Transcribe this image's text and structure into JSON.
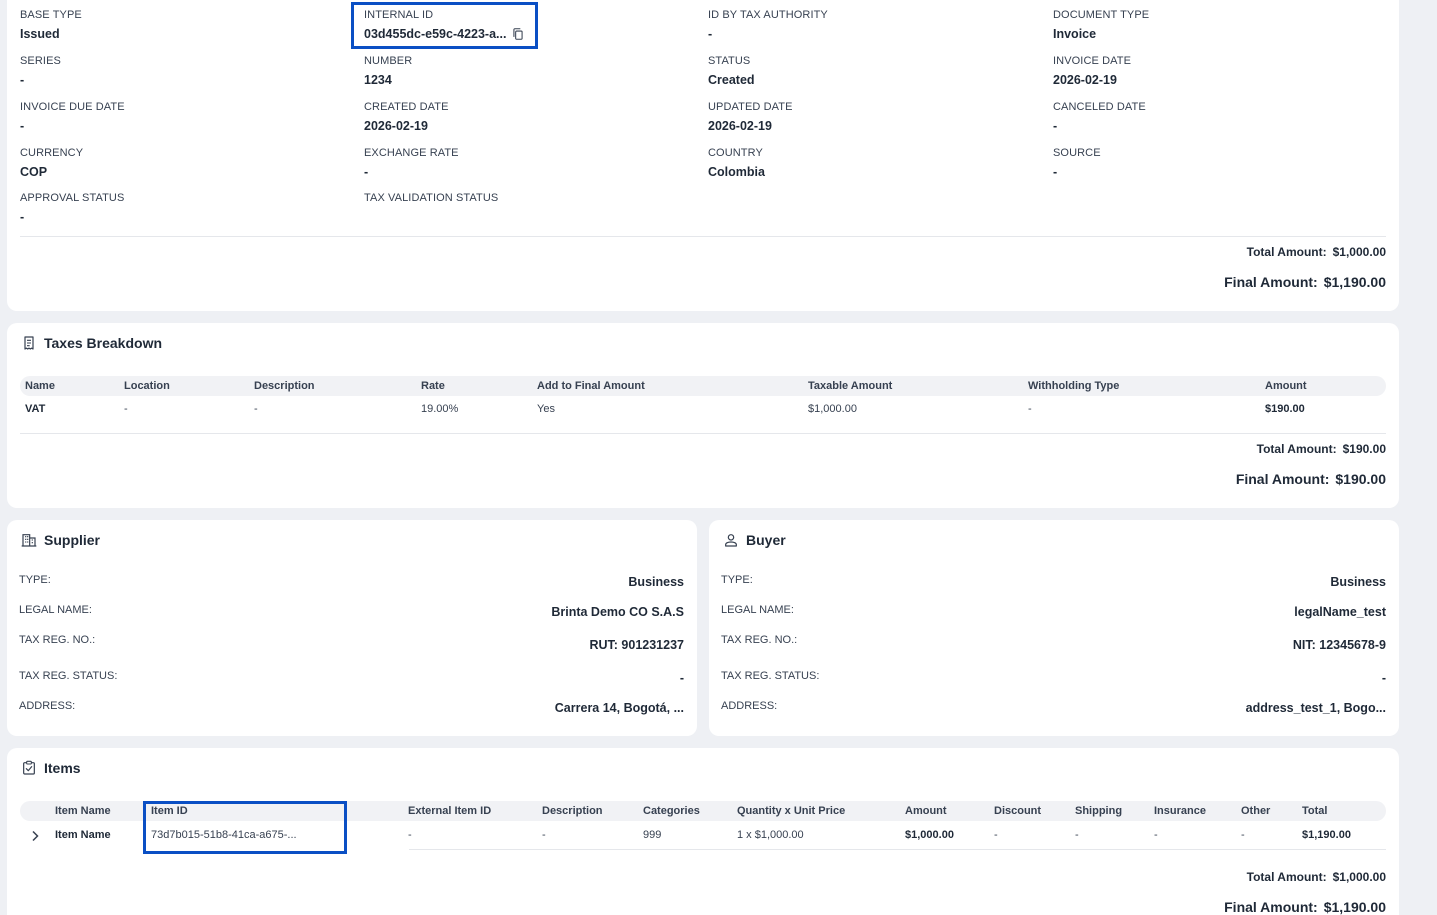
{
  "details": {
    "fields": [
      {
        "label": "BASE TYPE",
        "value": "Issued"
      },
      {
        "label": "INTERNAL ID",
        "value": "03d455dc-e59c-4223-a..."
      },
      {
        "label": "ID BY TAX AUTHORITY",
        "value": "-"
      },
      {
        "label": "DOCUMENT TYPE",
        "value": "Invoice"
      },
      {
        "label": "SERIES",
        "value": "-"
      },
      {
        "label": "NUMBER",
        "value": "1234"
      },
      {
        "label": "STATUS",
        "value": "Created"
      },
      {
        "label": "INVOICE DATE",
        "value": "2026-02-19"
      },
      {
        "label": "INVOICE DUE DATE",
        "value": "-"
      },
      {
        "label": "CREATED DATE",
        "value": "2026-02-19"
      },
      {
        "label": "UPDATED DATE",
        "value": "2026-02-19"
      },
      {
        "label": "CANCELED DATE",
        "value": "-"
      },
      {
        "label": "CURRENCY",
        "value": "COP"
      },
      {
        "label": "EXCHANGE RATE",
        "value": "-"
      },
      {
        "label": "COUNTRY",
        "value": "Colombia"
      },
      {
        "label": "SOURCE",
        "value": "-"
      },
      {
        "label": "APPROVAL STATUS",
        "value": "-"
      },
      {
        "label": "TAX VALIDATION STATUS",
        "value": ""
      }
    ],
    "total_label": "Total Amount:",
    "total_value": "$1,000.00",
    "final_label": "Final Amount:",
    "final_value": "$1,190.00"
  },
  "taxes": {
    "title": "Taxes Breakdown",
    "columns": [
      "Name",
      "Location",
      "Description",
      "Rate",
      "Add to Final Amount",
      "Taxable Amount",
      "Withholding Type",
      "Amount"
    ],
    "rows": [
      [
        "VAT",
        "-",
        "-",
        "19.00%",
        "Yes",
        "$1,000.00",
        "-",
        "$190.00"
      ]
    ],
    "total_label": "Total Amount:",
    "total_value": "$190.00",
    "final_label": "Final Amount:",
    "final_value": "$190.00"
  },
  "supplier": {
    "title": "Supplier",
    "rows": [
      {
        "label": "TYPE:",
        "value": "Business"
      },
      {
        "label": "LEGAL NAME:",
        "value": "Brinta Demo CO S.A.S"
      },
      {
        "label": "TAX REG. NO.:",
        "value": "RUT: 901231237"
      },
      {
        "label": "TAX REG. STATUS:",
        "value": "-"
      },
      {
        "label": "ADDRESS:",
        "value": "Carrera 14, Bogotá, ..."
      }
    ]
  },
  "buyer": {
    "title": "Buyer",
    "rows": [
      {
        "label": "TYPE:",
        "value": "Business"
      },
      {
        "label": "LEGAL NAME:",
        "value": "legalName_test"
      },
      {
        "label": "TAX REG. NO.:",
        "value": "NIT: 12345678-9"
      },
      {
        "label": "TAX REG. STATUS:",
        "value": "-"
      },
      {
        "label": "ADDRESS:",
        "value": "address_test_1, Bogo..."
      }
    ]
  },
  "items": {
    "title": "Items",
    "columns": [
      "Item Name",
      "Item ID",
      "External Item ID",
      "Description",
      "Categories",
      "Quantity x Unit Price",
      "Amount",
      "Discount",
      "Shipping",
      "Insurance",
      "Other",
      "Total"
    ],
    "rows": [
      [
        "Item Name",
        "73d7b015-51b8-41ca-a675-...",
        "-",
        "-",
        "999",
        "1 x $1,000.00",
        "$1,000.00",
        "-",
        "-",
        "-",
        "-",
        "$1,190.00"
      ]
    ],
    "total_label": "Total Amount:",
    "total_value": "$1,000.00",
    "final_label": "Final Amount:",
    "final_value": "$1,190.00"
  },
  "colors": {
    "highlight": "#0a4fc4",
    "card": "#ffffff",
    "background": "#eef0f4"
  }
}
